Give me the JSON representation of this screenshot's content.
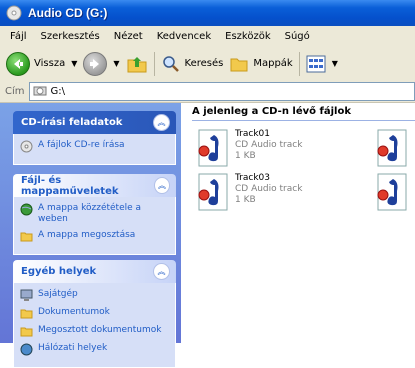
{
  "window": {
    "title": "Audio CD (G:)"
  },
  "menu": [
    "Fájl",
    "Szerkesztés",
    "Nézet",
    "Kedvencek",
    "Eszközök",
    "Súgó"
  ],
  "toolbar": {
    "back": "Vissza",
    "search": "Keresés",
    "folders": "Mappák"
  },
  "address": {
    "label": "Cím",
    "value": "G:\\"
  },
  "tasks": {
    "cd": {
      "title": "CD-írási feladatok",
      "items": [
        "A fájlok CD-re írása"
      ]
    },
    "file": {
      "title": "Fájl- és mappaműveletek",
      "items": [
        "A mappa közzététele a weben",
        "A mappa megosztása"
      ]
    },
    "other": {
      "title": "Egyéb helyek",
      "items": [
        "Sajátgép",
        "Dokumentumok",
        "Megosztott dokumentumok",
        "Hálózati helyek"
      ]
    }
  },
  "content": {
    "header": "A jelenleg a CD-n lévő fájlok",
    "files": [
      {
        "name": "Track01",
        "type": "CD Audio track",
        "size": "1 KB"
      },
      {
        "name": "Track03",
        "type": "CD Audio track",
        "size": "1 KB"
      }
    ]
  },
  "colors": {
    "titlebar": "#0a5fd8",
    "taskpane": "#7ba2e7",
    "link": "#215dc6"
  }
}
